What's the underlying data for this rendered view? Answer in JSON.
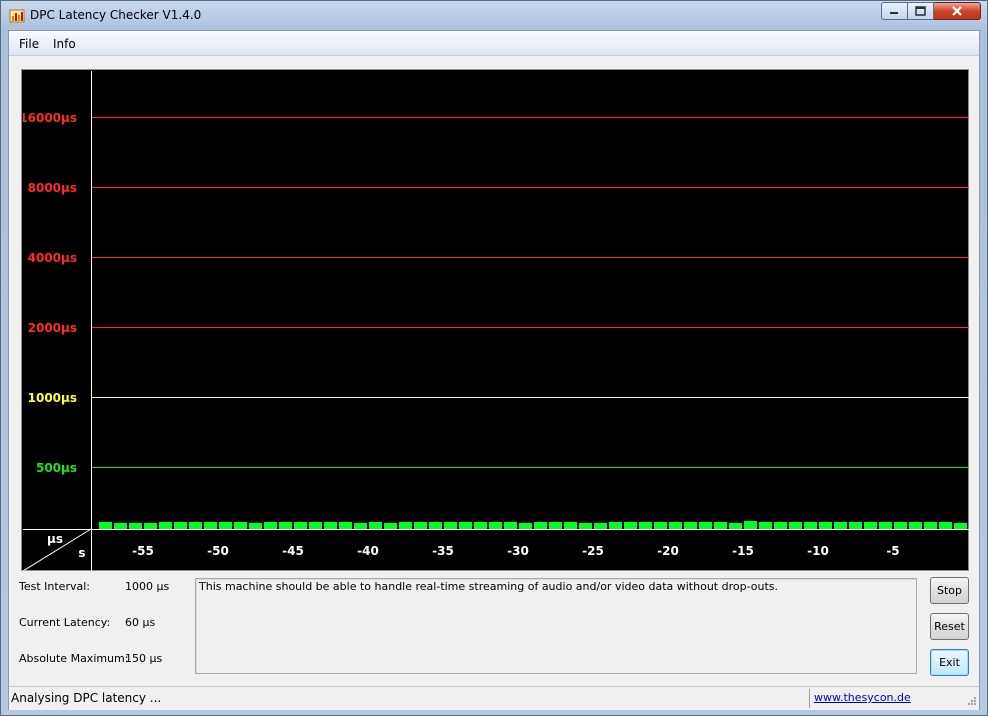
{
  "window": {
    "title": "DPC Latency Checker V1.4.0"
  },
  "menu": {
    "file": "File",
    "info": "Info"
  },
  "graph": {
    "y_markers": [
      {
        "label": "16000µs",
        "color": "#ff2a2a"
      },
      {
        "label": "8000µs",
        "color": "#ff2a2a"
      },
      {
        "label": "4000µs",
        "color": "#ff2a2a"
      },
      {
        "label": "2000µs",
        "color": "#ff2a2a"
      },
      {
        "label": "1000µs",
        "color": "#ffff40"
      },
      {
        "label": "500µs",
        "color": "#22e022"
      }
    ],
    "axis_unit_y": "µs",
    "axis_unit_x": "s",
    "x_ticks": [
      "-55",
      "-50",
      "-45",
      "-40",
      "-35",
      "-30",
      "-25",
      "-20",
      "-15",
      "-10",
      "-5"
    ],
    "bar_color": "#00ff22",
    "bar_values_us": [
      52,
      72,
      52,
      55,
      52,
      66,
      70,
      77,
      58,
      58,
      58,
      52,
      70,
      60,
      58,
      58,
      58,
      58,
      56,
      58,
      52,
      62,
      62,
      60,
      72,
      70,
      70,
      60,
      58,
      52,
      60,
      62,
      62,
      56,
      52,
      58,
      62,
      66,
      68,
      60,
      72,
      58,
      60,
      54,
      82,
      66,
      60,
      60,
      72,
      60,
      62,
      60,
      60,
      60,
      60,
      66,
      60,
      60,
      56
    ]
  },
  "stats": [
    {
      "label": "Test Interval:",
      "value": "1000 µs"
    },
    {
      "label": "Current Latency:",
      "value": "60 µs"
    },
    {
      "label": "Absolute Maximum:",
      "value": "150 µs"
    }
  ],
  "message": "This machine should be able to handle real-time streaming of audio and/or video data without drop-outs.",
  "buttons": {
    "stop": "Stop",
    "reset": "Reset",
    "exit": "Exit"
  },
  "status": {
    "text": "Analysing DPC latency ...",
    "link": "www.thesycon.de"
  }
}
